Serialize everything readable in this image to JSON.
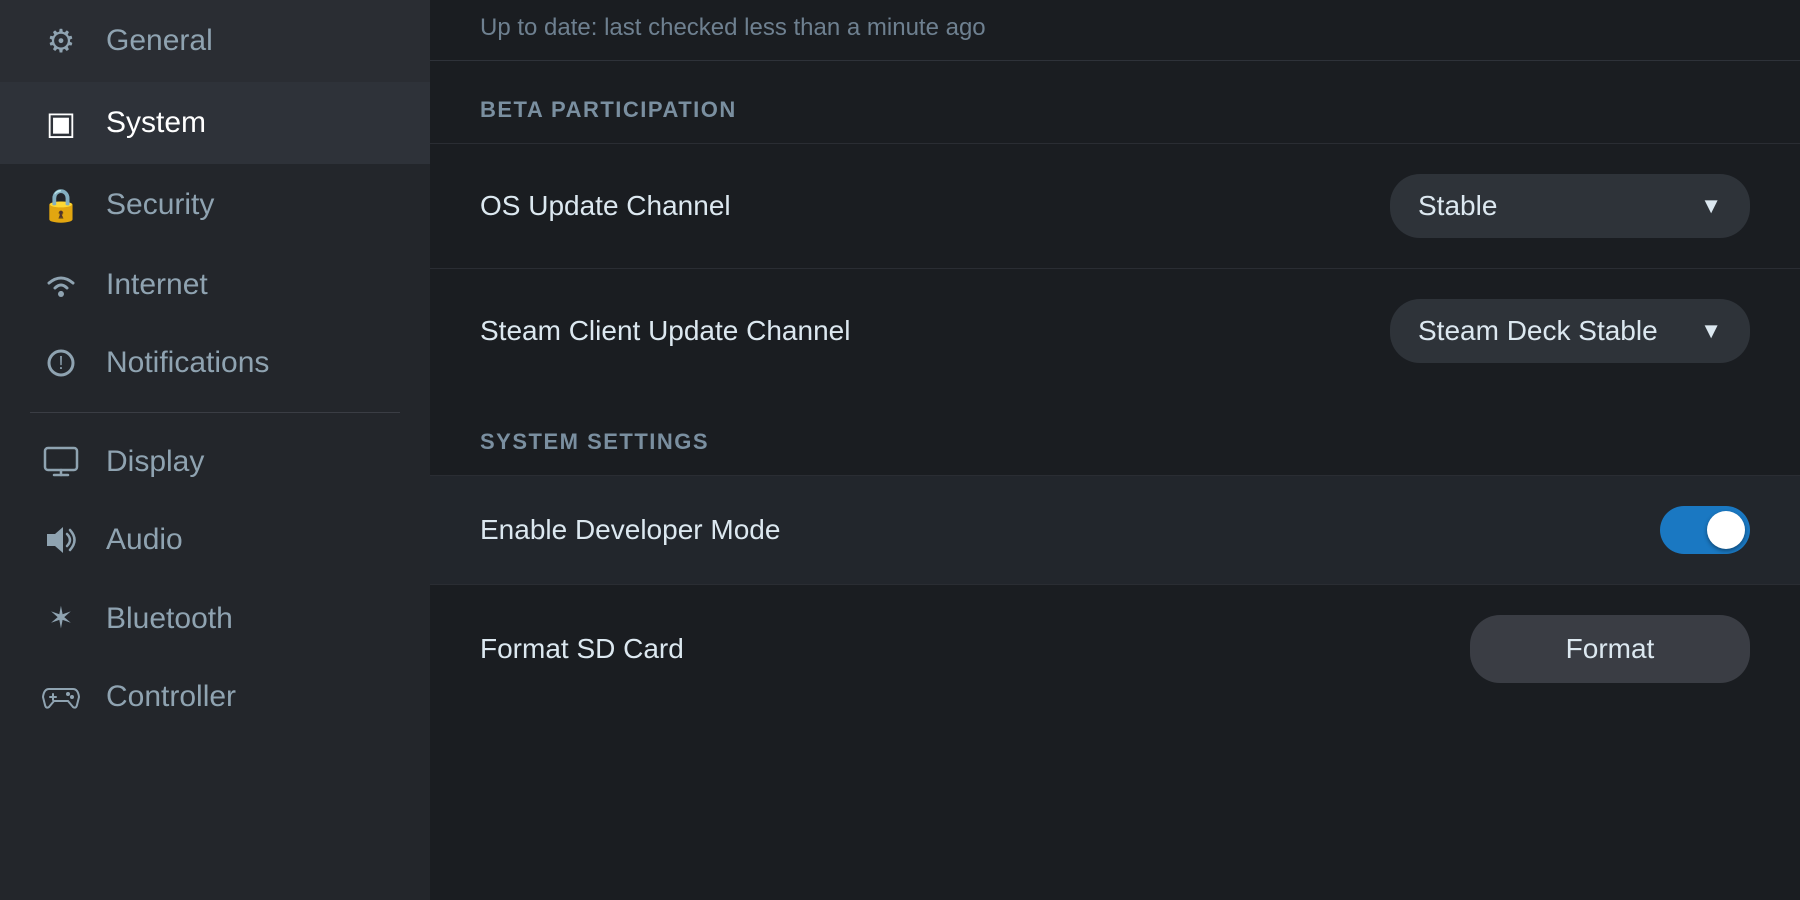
{
  "sidebar": {
    "items": [
      {
        "id": "general",
        "label": "General",
        "icon": "gear",
        "active": false
      },
      {
        "id": "system",
        "label": "System",
        "icon": "system",
        "active": true
      },
      {
        "id": "security",
        "label": "Security",
        "icon": "lock",
        "active": false
      },
      {
        "id": "internet",
        "label": "Internet",
        "icon": "wifi",
        "active": false
      },
      {
        "id": "notifications",
        "label": "Notifications",
        "icon": "bell",
        "active": false
      },
      {
        "id": "display",
        "label": "Display",
        "icon": "monitor",
        "active": false
      },
      {
        "id": "audio",
        "label": "Audio",
        "icon": "audio",
        "active": false
      },
      {
        "id": "bluetooth",
        "label": "Bluetooth",
        "icon": "bluetooth",
        "active": false
      },
      {
        "id": "controller",
        "label": "Controller",
        "icon": "controller",
        "active": false
      }
    ]
  },
  "main": {
    "top_status": "Up to date: last checked less than a minute ago",
    "beta_section_header": "BETA PARTICIPATION",
    "os_update_channel_label": "OS Update Channel",
    "os_update_channel_value": "Stable",
    "steam_client_update_label": "Steam Client Update Channel",
    "steam_client_update_value": "Steam Deck Stable",
    "system_settings_header": "SYSTEM SETTINGS",
    "developer_mode_label": "Enable Developer Mode",
    "developer_mode_enabled": true,
    "format_sd_card_label": "Format SD Card",
    "format_button_label": "Format"
  },
  "icons": {
    "gear": "⚙",
    "system": "▣",
    "lock": "🔒",
    "wifi": "〜",
    "bell": "🔔",
    "monitor": "🖥",
    "audio": "🔊",
    "bluetooth": "✶",
    "controller": "🎮",
    "chevron_down": "▼"
  }
}
